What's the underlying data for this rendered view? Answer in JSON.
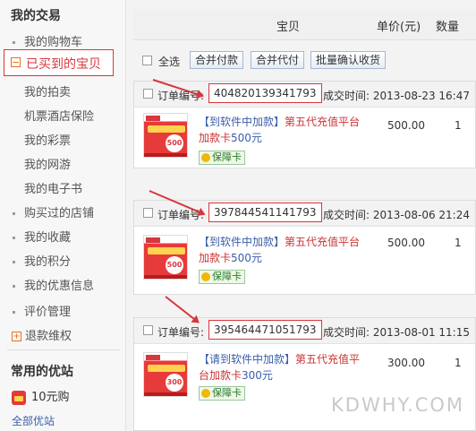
{
  "sidebar": {
    "section1_title": "我的交易",
    "items": [
      {
        "label": "我的购物车"
      },
      {
        "label": "已买到的宝贝"
      },
      {
        "label": "我的拍卖"
      },
      {
        "label": "机票酒店保险"
      },
      {
        "label": "我的彩票"
      },
      {
        "label": "我的网游"
      },
      {
        "label": "我的电子书"
      },
      {
        "label": "购买过的店铺"
      },
      {
        "label": "我的收藏"
      },
      {
        "label": "我的积分"
      },
      {
        "label": "我的优惠信息"
      },
      {
        "label": "评价管理"
      },
      {
        "label": "退款维权"
      }
    ],
    "section2_title": "常用的优站",
    "fav_item": "10元购",
    "all_link": "全部优站"
  },
  "header": {
    "col_item": "宝贝",
    "col_price": "单价(元)",
    "col_qty": "数量"
  },
  "toolbar": {
    "select_all": "全选",
    "merge_pay": "合并付款",
    "merge_proxy": "合并代付",
    "batch_confirm": "批量确认收货"
  },
  "orders": [
    {
      "label": "订单编号:",
      "number": "404820139341793",
      "time": "成交时间: 2013-08-23 16:47",
      "prefix": "【到软件中加款】",
      "name": "第五代充值平台",
      "line2_blue": "加款卡",
      "line2_amount": "500元",
      "badge": "保障卡",
      "thumb_value": "500",
      "price": "500.00",
      "qty": "1"
    },
    {
      "label": "订单编号:",
      "number": "397844541141793",
      "time": "成交时间: 2013-08-06 21:24",
      "prefix": "【到软件中加款】",
      "name": "第五代充值平台",
      "line2_blue": "加款卡",
      "line2_amount": "500元",
      "badge": "保障卡",
      "thumb_value": "500",
      "price": "500.00",
      "qty": "1"
    },
    {
      "label": "订单编号:",
      "number": "395464471051793",
      "time": "成交时间: 2013-08-01 11:15",
      "prefix": "【请到软件中加款】",
      "name": "第五代充值平",
      "line2_blue": "台加款卡",
      "line2_amount": "300元",
      "badge": "保障卡",
      "thumb_value": "300",
      "price": "300.00",
      "qty": "1"
    }
  ],
  "watermark": "KDWHY.COM",
  "colors": {
    "accent_red": "#d9363e",
    "link_blue": "#3a5eaa",
    "title_red": "#cc3333"
  }
}
